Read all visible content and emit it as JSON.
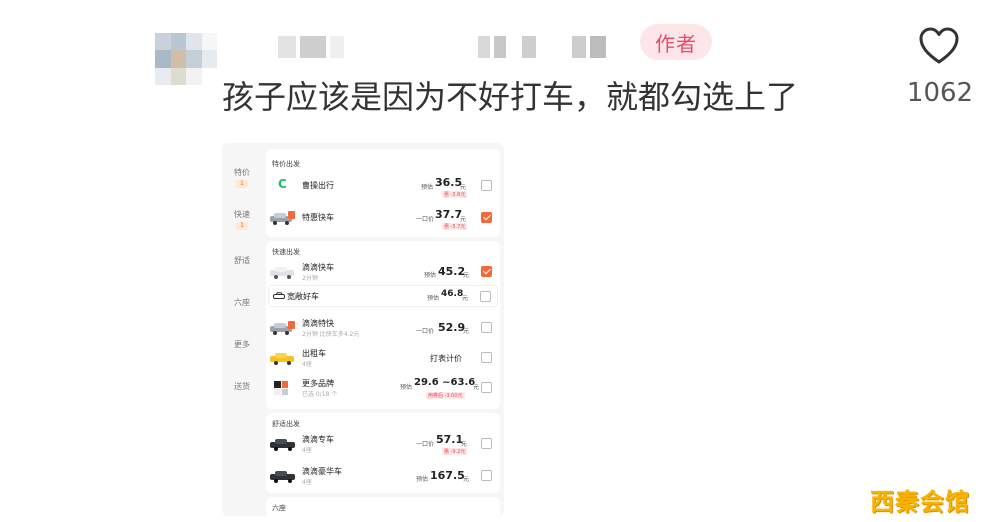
{
  "comment": {
    "author_badge": "作者",
    "text": "孩子应该是因为不好打车，就都勾选上了",
    "like_count": "1062"
  },
  "screenshot": {
    "sidebar": [
      {
        "label": "特价",
        "badge": "1"
      },
      {
        "label": "快速",
        "badge": "1"
      },
      {
        "label": "舒适"
      },
      {
        "label": "六座"
      },
      {
        "label": "更多"
      },
      {
        "label": "送货"
      }
    ],
    "sections": [
      {
        "title": "特价出发",
        "rows": [
          {
            "name": "曹操出行",
            "price_label": "预估",
            "price": "36.5",
            "unit": "元",
            "tag": "惠 -3.8元",
            "checked": false
          },
          {
            "name": "特惠快车",
            "price_label": "一口价",
            "price": "37.7",
            "unit": "元",
            "tag": "惠 -5.7元",
            "checked": true
          }
        ]
      },
      {
        "title": "快速出发",
        "rows": [
          {
            "name": "滴滴快车",
            "sub": "2分钟",
            "price_label": "预估",
            "price": "45.2",
            "unit": "元",
            "checked": true
          },
          {
            "name": "宽敞好车",
            "price_label": "预估",
            "price": "46.8",
            "unit": "元",
            "checked": false
          },
          {
            "name": "滴滴特快",
            "sub": "2分钟 比快车多4.2元",
            "price_label": "一口价",
            "price": "52.9",
            "unit": "元",
            "checked": false
          },
          {
            "name": "出租车",
            "sub": "4座",
            "meter_text": "打表计价",
            "checked": false
          },
          {
            "name": "更多品牌",
            "sub": "已选 0/18 个",
            "price_label": "预估",
            "price": "29.6 ~63.6",
            "unit": "元",
            "tag": "用券后 -3.00元",
            "checked": false
          }
        ]
      },
      {
        "title": "舒适出发",
        "rows": [
          {
            "name": "滴滴专车",
            "sub": "4座",
            "price_label": "一口价",
            "price": "57.1",
            "unit": "元",
            "tag": "惠 -9.2元",
            "checked": false
          },
          {
            "name": "滴滴豪华车",
            "sub": "4座",
            "price_label": "预估",
            "price": "167.5",
            "unit": "元",
            "checked": false
          }
        ]
      },
      {
        "title": "六座"
      }
    ]
  },
  "watermark": "西秦会馆",
  "colors": {
    "accent": "#f26a3a",
    "badge_bg": "#fde6ea",
    "badge_text": "#e84d6a",
    "watermark": "#f5b400"
  }
}
